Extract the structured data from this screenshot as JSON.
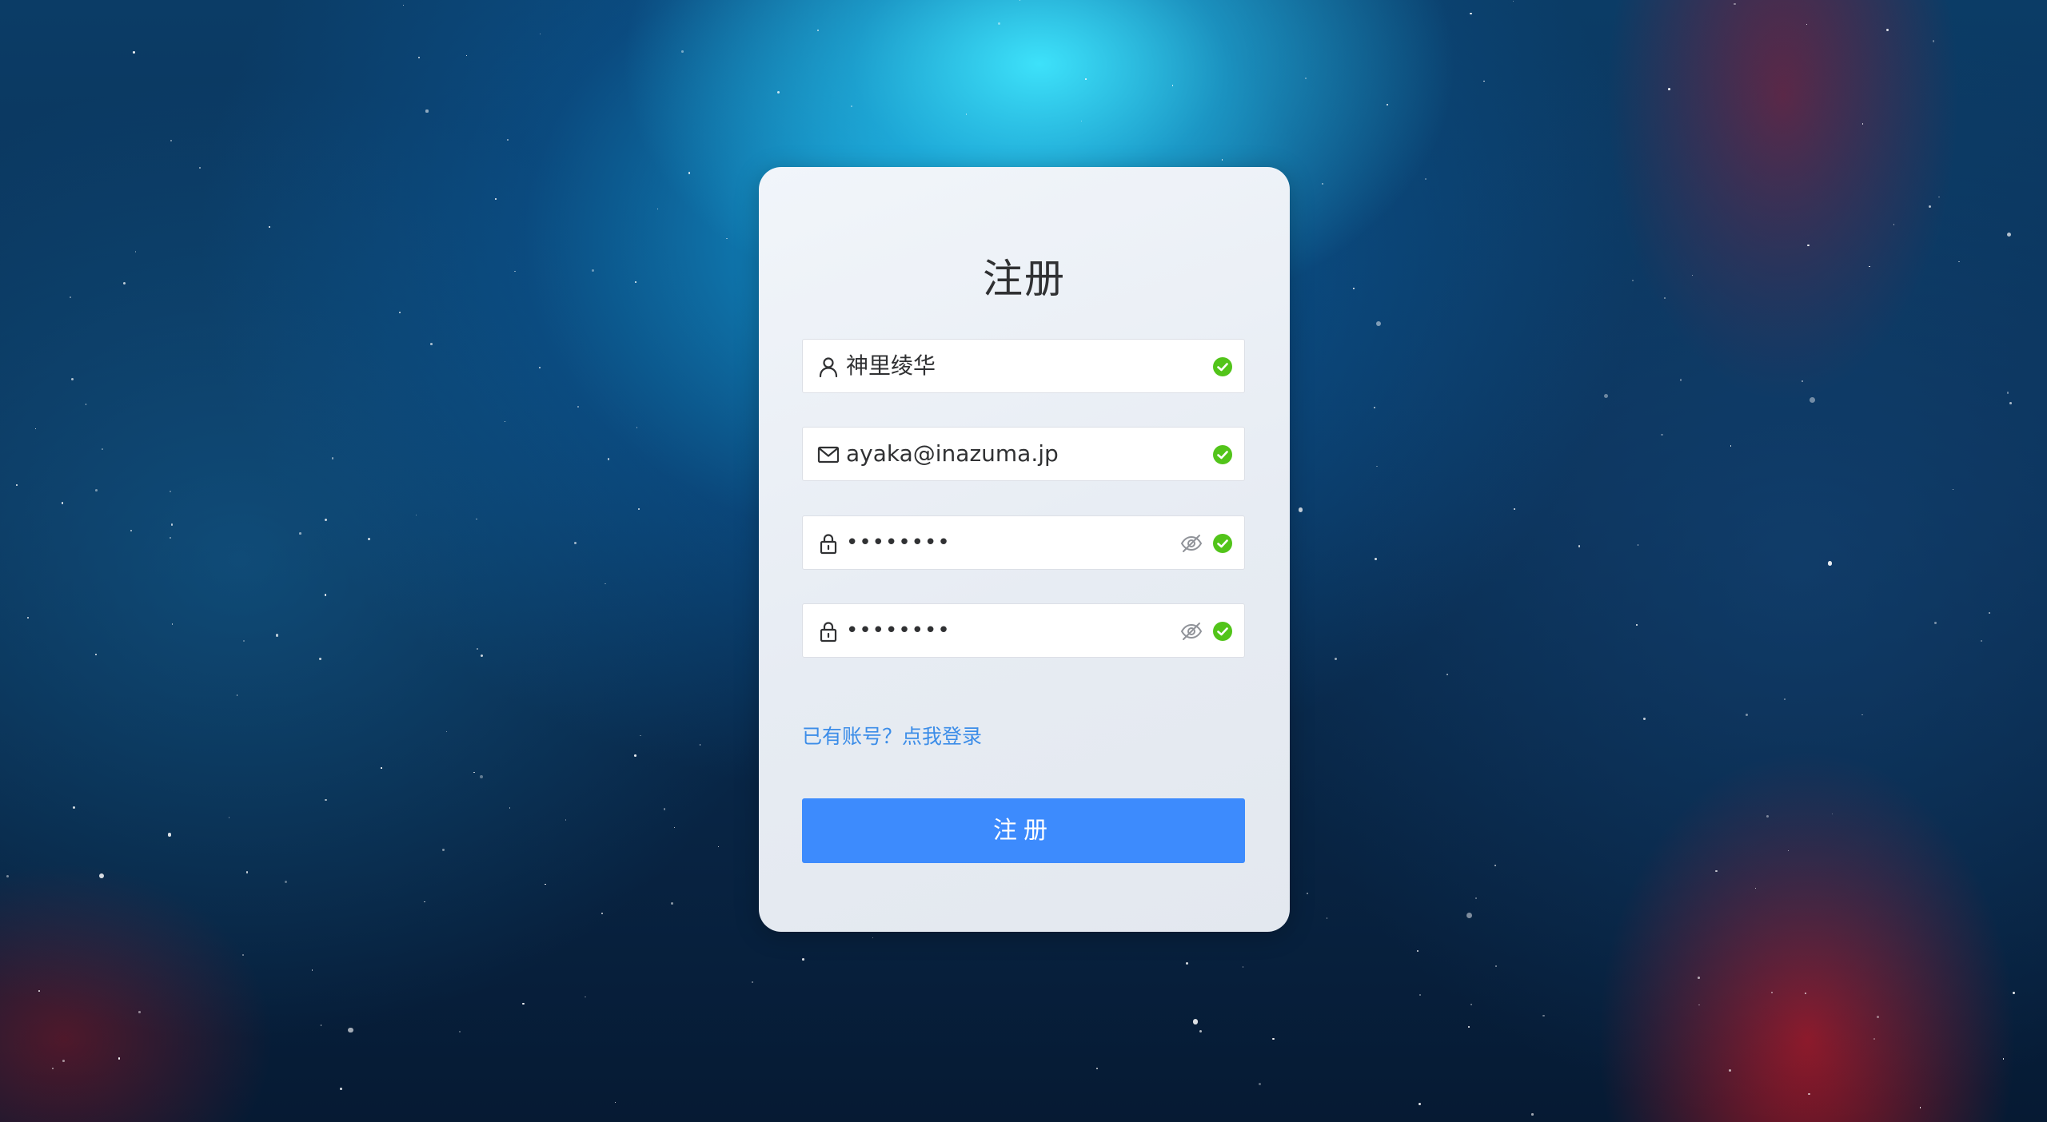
{
  "form": {
    "title": "注册",
    "fields": [
      {
        "icon": "user-icon",
        "value": "神里绫华",
        "valid": true
      },
      {
        "icon": "mail-icon",
        "value": "ayaka@inazuma.jp",
        "valid": true
      },
      {
        "icon": "lock-icon",
        "value": "••••••••",
        "valid": true,
        "toggle_icon": "eye-off-icon"
      },
      {
        "icon": "lock-icon",
        "value": "••••••••",
        "valid": true,
        "toggle_icon": "eye-off-icon"
      }
    ],
    "login_link": "已有账号？点我登录",
    "submit_label": "注册"
  },
  "colors": {
    "accent": "#3d8bfd",
    "link": "#3c8de8",
    "success": "#67c23a",
    "text": "#303133"
  }
}
